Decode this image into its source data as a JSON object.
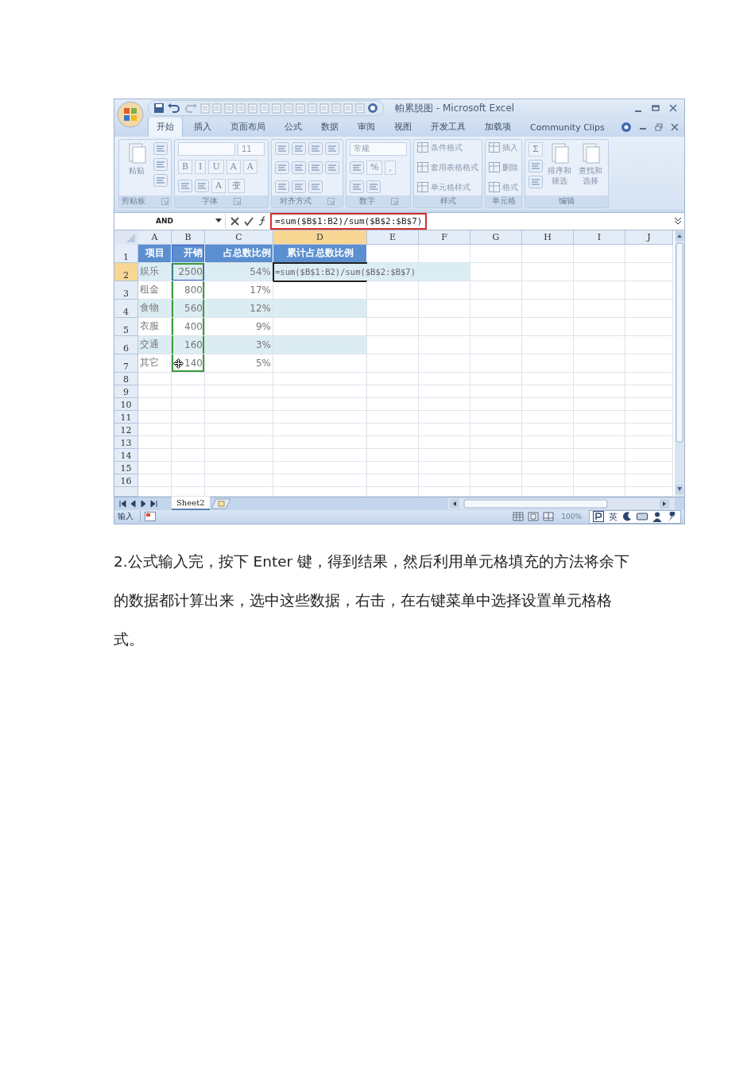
{
  "excel": {
    "title": "帕累脱图 - Microsoft Excel",
    "tabs": [
      {
        "label": "开始",
        "selected": true
      },
      {
        "label": "插入",
        "selected": false
      },
      {
        "label": "页面布局",
        "selected": false
      },
      {
        "label": "公式",
        "selected": false
      },
      {
        "label": "数据",
        "selected": false
      },
      {
        "label": "审阅",
        "selected": false
      },
      {
        "label": "视图",
        "selected": false
      },
      {
        "label": "开发工具",
        "selected": false
      },
      {
        "label": "加载项",
        "selected": false
      },
      {
        "label": "Community Clips",
        "selected": false
      }
    ],
    "ribbon": [
      {
        "label": "剪贴板",
        "launcher": true,
        "stacks": [
          [
            {
              "kind": "big",
              "label": "粘贴"
            }
          ],
          [
            {
              "kind": "icon"
            },
            {
              "kind": "icon"
            },
            {
              "kind": "icon"
            }
          ]
        ]
      },
      {
        "label": "字体",
        "launcher": true,
        "lines": [
          [
            {
              "kind": "field"
            },
            {
              "kind": "field",
              "value": "11"
            }
          ],
          [
            {
              "kind": "glyph",
              "text": "B"
            },
            {
              "kind": "glyph",
              "text": "I"
            },
            {
              "kind": "glyph",
              "text": "U"
            },
            {
              "kind": "glyph",
              "text": "A"
            },
            {
              "kind": "glyph",
              "text": "A"
            }
          ],
          [
            {
              "kind": "icon"
            },
            {
              "kind": "icon"
            },
            {
              "kind": "glyph",
              "text": "A"
            },
            {
              "kind": "glyph",
              "text": "变"
            }
          ]
        ]
      },
      {
        "label": "对齐方式",
        "launcher": true,
        "lines": [
          [
            {
              "kind": "icon"
            },
            {
              "kind": "icon"
            },
            {
              "kind": "icon"
            },
            {
              "kind": "icon"
            }
          ],
          [
            {
              "kind": "icon"
            },
            {
              "kind": "icon"
            },
            {
              "kind": "icon"
            },
            {
              "kind": "icon"
            }
          ],
          [
            {
              "kind": "icon"
            },
            {
              "kind": "icon"
            },
            {
              "kind": "icon"
            }
          ]
        ]
      },
      {
        "label": "数字",
        "launcher": true,
        "lines": [
          [
            {
              "kind": "field",
              "value": "常规"
            }
          ],
          [
            {
              "kind": "icon"
            },
            {
              "kind": "glyph",
              "text": "%"
            },
            {
              "kind": "glyph",
              "text": ","
            }
          ],
          [
            {
              "kind": "icon"
            },
            {
              "kind": "icon"
            }
          ]
        ]
      },
      {
        "label": "样式",
        "launcher": false,
        "lines": [
          [
            {
              "kind": "small",
              "label": "条件格式"
            }
          ],
          [
            {
              "kind": "small",
              "label": "套用表格格式"
            }
          ],
          [
            {
              "kind": "small",
              "label": "单元格样式"
            }
          ]
        ]
      },
      {
        "label": "单元格",
        "launcher": false,
        "lines": [
          [
            {
              "kind": "small",
              "label": "插入"
            }
          ],
          [
            {
              "kind": "small",
              "label": "删除"
            }
          ],
          [
            {
              "kind": "small",
              "label": "格式"
            }
          ]
        ]
      },
      {
        "label": "编辑",
        "launcher": false,
        "stacks": [
          [
            {
              "kind": "glyph",
              "text": "Σ"
            },
            {
              "kind": "icon"
            },
            {
              "kind": "icon"
            }
          ],
          [
            {
              "kind": "big",
              "label": "排序和筛选"
            }
          ],
          [
            {
              "kind": "big",
              "label": "查找和选择"
            }
          ]
        ]
      }
    ],
    "name_box": "AND",
    "formula": {
      "value": "=sum($B$1:B2)/sum($B$2:$B$7)",
      "highlighted": true
    },
    "columns": [
      {
        "label": "A",
        "selected": false
      },
      {
        "label": "B",
        "selected": false
      },
      {
        "label": "C",
        "selected": false
      },
      {
        "label": "D",
        "selected": true
      },
      {
        "label": "E",
        "selected": false
      },
      {
        "label": "F",
        "selected": false
      },
      {
        "label": "G",
        "selected": false
      },
      {
        "label": "H",
        "selected": false
      },
      {
        "label": "I",
        "selected": false
      },
      {
        "label": "J",
        "selected": false
      }
    ],
    "rows": [
      {
        "label": "1",
        "selected": false,
        "kind": "header",
        "cells": [
          {
            "text": "项目"
          },
          {
            "text": "开销",
            "range_1": true
          },
          {
            "text": "占总数比例"
          },
          {
            "text": "累计占总数比例"
          }
        ]
      },
      {
        "label": "2",
        "selected": true,
        "kind": "data",
        "cells": [
          {
            "text": "娱乐"
          },
          {
            "text": "2500",
            "range_1": true,
            "range_2": true
          },
          {
            "text": "54%"
          },
          {
            "text": "=sum($B$1:B2)/sum($B$2:$B$7)",
            "active": true
          }
        ]
      },
      {
        "label": "3",
        "selected": false,
        "kind": "data",
        "cells": [
          {
            "text": "租金"
          },
          {
            "text": "800",
            "range_2": true
          },
          {
            "text": "17%"
          },
          {}
        ]
      },
      {
        "label": "4",
        "selected": false,
        "kind": "data",
        "cells": [
          {
            "text": "食物"
          },
          {
            "text": "560",
            "range_2": true
          },
          {
            "text": "12%"
          },
          {}
        ]
      },
      {
        "label": "5",
        "selected": false,
        "kind": "data",
        "cells": [
          {
            "text": "衣服"
          },
          {
            "text": "400",
            "range_2": true
          },
          {
            "text": "9%"
          },
          {}
        ]
      },
      {
        "label": "6",
        "selected": false,
        "kind": "data",
        "cells": [
          {
            "text": "交通"
          },
          {
            "text": "160",
            "range_2": true
          },
          {
            "text": "3%"
          },
          {}
        ]
      },
      {
        "label": "7",
        "selected": false,
        "kind": "data",
        "cells": [
          {
            "text": "其它"
          },
          {
            "text": "140",
            "range_2": true,
            "pointer": true
          },
          {
            "text": "5%"
          },
          {}
        ]
      },
      {
        "label": "8",
        "selected": false,
        "kind": "empty"
      },
      {
        "label": "9",
        "selected": false,
        "kind": "empty"
      },
      {
        "label": "10",
        "selected": false,
        "kind": "empty"
      },
      {
        "label": "11",
        "selected": false,
        "kind": "empty"
      },
      {
        "label": "12",
        "selected": false,
        "kind": "empty"
      },
      {
        "label": "13",
        "selected": false,
        "kind": "empty"
      },
      {
        "label": "14",
        "selected": false,
        "kind": "empty"
      },
      {
        "label": "15",
        "selected": false,
        "kind": "empty"
      },
      {
        "label": "16",
        "selected": false,
        "kind": "empty"
      }
    ],
    "sheet_tabs": [
      {
        "label": "Sheet2",
        "selected": true
      }
    ],
    "status": {
      "mode": "输入",
      "zoom": "100%",
      "ime": "英"
    }
  },
  "paragraphs": [
    "2.公式输入完，按下 Enter 键，得到结果，然后利用单元格填充的方法将余下的数据都计算出来，选中这些数据，右击，在右键菜单中选择设置单元格格式。"
  ]
}
